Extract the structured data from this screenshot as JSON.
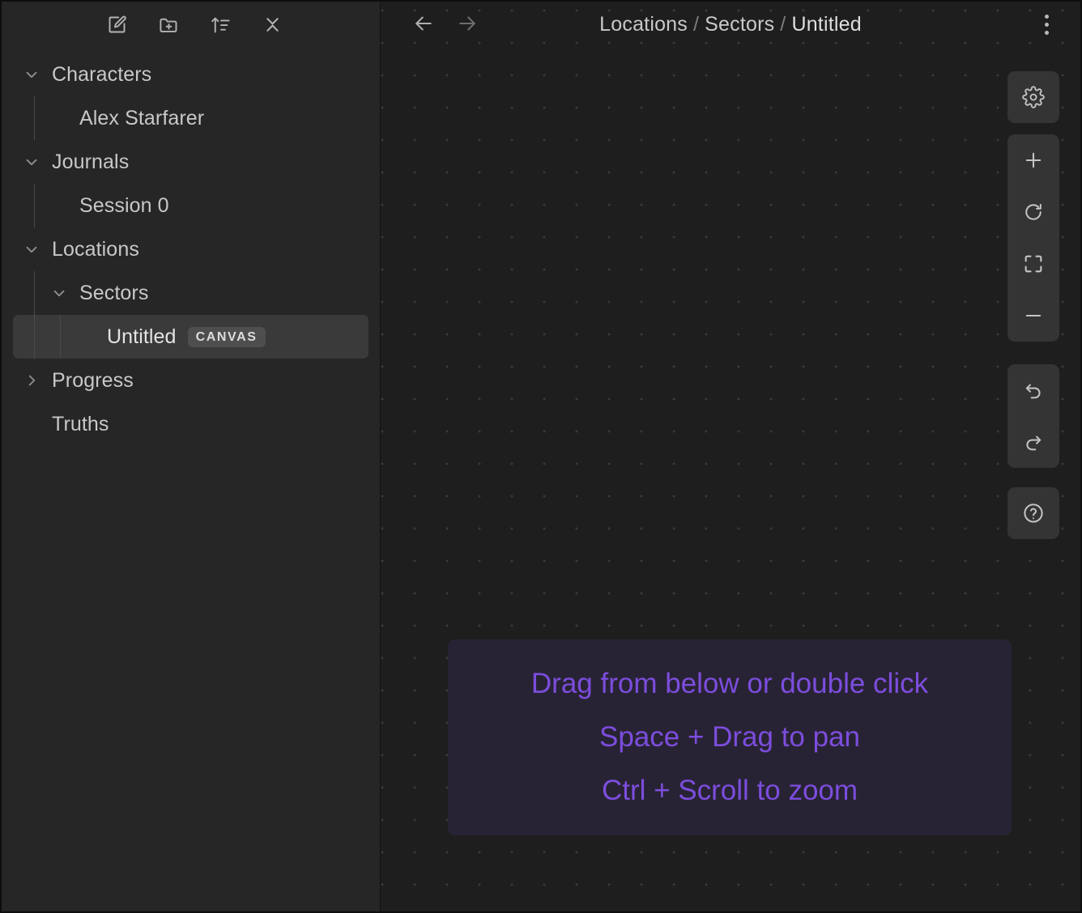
{
  "sidebar": {
    "toolbar": [
      {
        "name": "new-entry-button",
        "icon": "square-pencil-icon",
        "label": "New entry"
      },
      {
        "name": "new-folder-button",
        "icon": "folder-plus-icon",
        "label": "New folder"
      },
      {
        "name": "sort-button",
        "icon": "sort-ascending-icon",
        "label": "Sort"
      },
      {
        "name": "collapse-all-button",
        "icon": "collapse-all-icon",
        "label": "Collapse all"
      }
    ],
    "tree": [
      {
        "label": "Characters",
        "depth": 0,
        "expanded": true,
        "chevron": "chevron-down",
        "selected": false,
        "badge": ""
      },
      {
        "label": "Alex Starfarer",
        "depth": 1,
        "expanded": null,
        "chevron": "",
        "selected": false,
        "badge": ""
      },
      {
        "label": "Journals",
        "depth": 0,
        "expanded": true,
        "chevron": "chevron-down",
        "selected": false,
        "badge": ""
      },
      {
        "label": "Session 0",
        "depth": 1,
        "expanded": null,
        "chevron": "",
        "selected": false,
        "badge": ""
      },
      {
        "label": "Locations",
        "depth": 0,
        "expanded": true,
        "chevron": "chevron-down",
        "selected": false,
        "badge": ""
      },
      {
        "label": "Sectors",
        "depth": 1,
        "expanded": true,
        "chevron": "chevron-down",
        "selected": false,
        "badge": ""
      },
      {
        "label": "Untitled",
        "depth": 2,
        "expanded": null,
        "chevron": "",
        "selected": true,
        "badge": "CANVAS"
      },
      {
        "label": "Progress",
        "depth": 0,
        "expanded": false,
        "chevron": "chevron-right",
        "selected": false,
        "badge": ""
      },
      {
        "label": "Truths",
        "depth": 0,
        "expanded": null,
        "chevron": "",
        "selected": false,
        "badge": ""
      }
    ]
  },
  "header": {
    "back_label": "Back",
    "forward_label": "Forward",
    "menu_label": "More options",
    "breadcrumb": [
      "Locations",
      "Sectors",
      "Untitled"
    ],
    "breadcrumb_separator": "/"
  },
  "canvas": {
    "toolbar_groups": [
      {
        "name": "settings-group",
        "buttons": [
          {
            "name": "canvas-settings-button",
            "icon": "gear-icon",
            "label": "Canvas settings"
          }
        ]
      },
      {
        "name": "zoom-group",
        "buttons": [
          {
            "name": "zoom-in-button",
            "icon": "plus-icon",
            "label": "Zoom in"
          },
          {
            "name": "reset-view-button",
            "icon": "refresh-icon",
            "label": "Reset view"
          },
          {
            "name": "fit-to-screen-button",
            "icon": "fit-screen-icon",
            "label": "Fit to screen"
          },
          {
            "name": "zoom-out-button",
            "icon": "minus-icon",
            "label": "Zoom out"
          }
        ]
      },
      {
        "name": "history-group",
        "buttons": [
          {
            "name": "undo-button",
            "icon": "undo-icon",
            "label": "Undo"
          },
          {
            "name": "redo-button",
            "icon": "redo-icon",
            "label": "Redo"
          }
        ]
      },
      {
        "name": "help-group",
        "buttons": [
          {
            "name": "help-button",
            "icon": "question-circle-icon",
            "label": "Help"
          }
        ]
      }
    ],
    "hint_panel": {
      "lines": [
        "Drag from below or double click",
        "Space + Drag to pan",
        "Ctrl + Scroll to zoom"
      ]
    }
  },
  "colors": {
    "window_background": "#1e1e1e",
    "sidebar_background": "#262626",
    "selected_row": "#3a3a3a",
    "badge_background": "#4e4e4e",
    "toolbar_panel": "#343434",
    "hint_panel_background": "#282334",
    "hint_text": "#7c4ddd",
    "grid_dot": "#3a3a3a"
  }
}
